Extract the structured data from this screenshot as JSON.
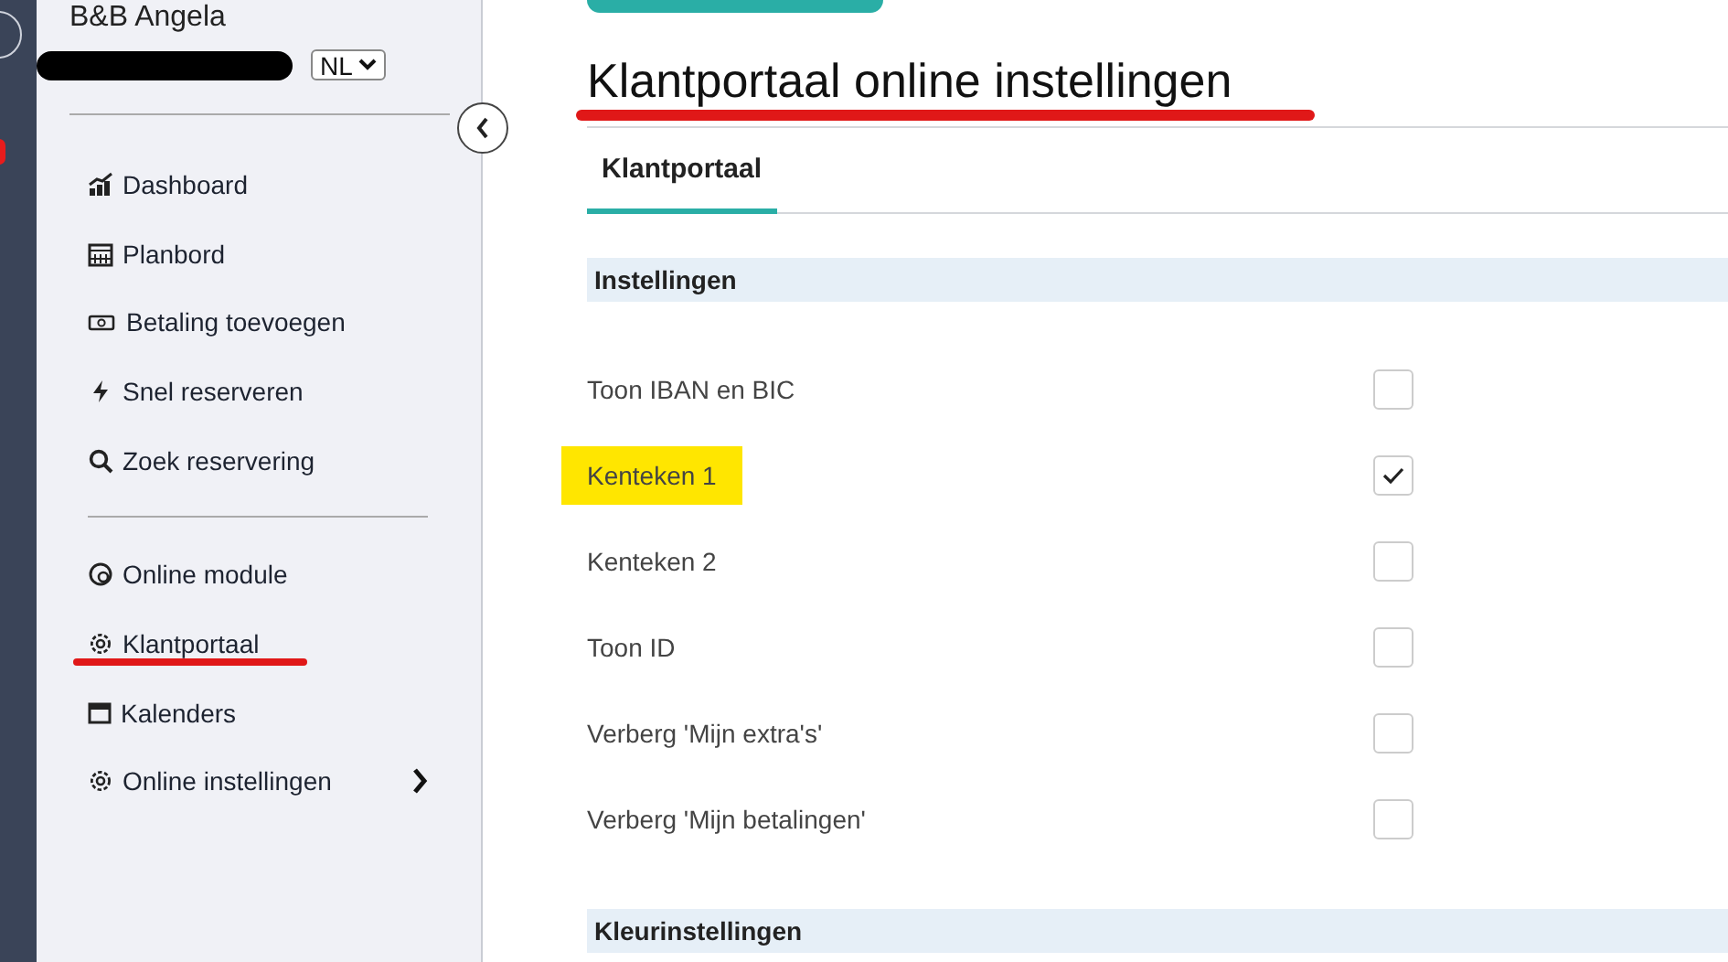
{
  "sidebar": {
    "business_name": "B&B Angela",
    "language": "NL",
    "groups": [
      {
        "items": [
          {
            "label": "Dashboard",
            "annotated": false,
            "expandable": false
          },
          {
            "label": "Planbord",
            "annotated": false,
            "expandable": false
          },
          {
            "label": "Betaling toevoegen",
            "annotated": false,
            "expandable": false
          },
          {
            "label": "Snel reserveren",
            "annotated": false,
            "expandable": false
          },
          {
            "label": "Zoek reservering",
            "annotated": false,
            "expandable": false
          }
        ]
      },
      {
        "items": [
          {
            "label": "Online module",
            "annotated": false,
            "expandable": false
          },
          {
            "label": "Klantportaal",
            "annotated": true,
            "expandable": false
          },
          {
            "label": "Kalenders",
            "annotated": false,
            "expandable": false
          },
          {
            "label": "Online instellingen",
            "annotated": false,
            "expandable": true
          }
        ]
      }
    ]
  },
  "page": {
    "title": "Klantportaal online instellingen",
    "title_annotated": true,
    "tabs": [
      {
        "label": "Klantportaal",
        "selected": true
      }
    ],
    "sections": [
      {
        "title": "Instellingen",
        "rows": [
          {
            "label": "Toon IBAN en BIC",
            "checked": false,
            "highlighted": false
          },
          {
            "label": "Kenteken 1",
            "checked": true,
            "highlighted": true
          },
          {
            "label": "Kenteken 2",
            "checked": false,
            "highlighted": false
          },
          {
            "label": "Toon ID",
            "checked": false,
            "highlighted": false
          },
          {
            "label": "Verberg 'Mijn extra's'",
            "checked": false,
            "highlighted": false
          },
          {
            "label": "Verberg 'Mijn betalingen'",
            "checked": false,
            "highlighted": false
          }
        ]
      },
      {
        "title": "Kleurinstellingen"
      }
    ]
  }
}
